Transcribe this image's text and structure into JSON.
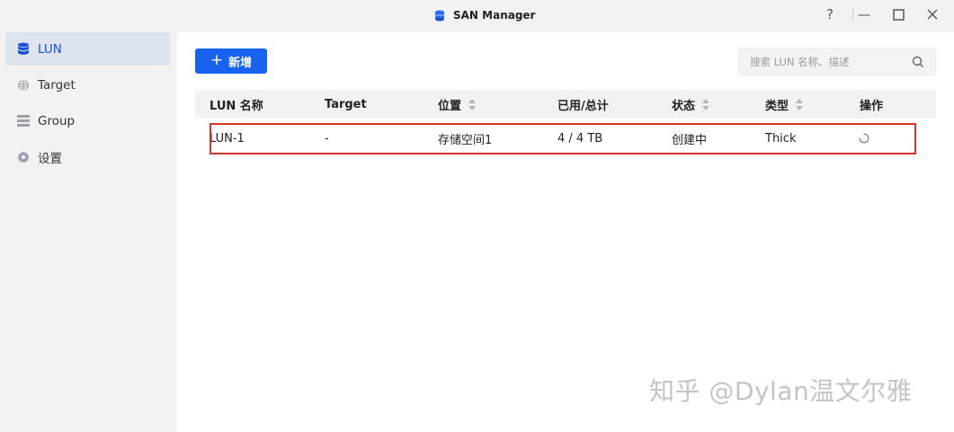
{
  "window": {
    "title": "SAN Manager",
    "controls": {
      "help": "?",
      "minimize": "—",
      "maximize": "☐",
      "close": "✕"
    }
  },
  "sidebar": {
    "items": [
      {
        "label": "LUN",
        "icon": "database-icon",
        "active": true
      },
      {
        "label": "Target",
        "icon": "globe-icon",
        "active": false
      },
      {
        "label": "Group",
        "icon": "list-icon",
        "active": false
      },
      {
        "label": "设置",
        "icon": "gear-icon",
        "active": false
      }
    ]
  },
  "toolbar": {
    "add_label": "新增",
    "search_placeholder": "搜索 LUN 名称、描述"
  },
  "table": {
    "columns": [
      {
        "label": "LUN 名称",
        "sortable": false
      },
      {
        "label": "Target",
        "sortable": false
      },
      {
        "label": "位置",
        "sortable": true
      },
      {
        "label": "已用/总计",
        "sortable": false
      },
      {
        "label": "状态",
        "sortable": true
      },
      {
        "label": "类型",
        "sortable": true
      },
      {
        "label": "操作",
        "sortable": false
      }
    ],
    "rows": [
      {
        "name": "LUN-1",
        "target": "-",
        "location": "存储空间1",
        "usage": "4 / 4 TB",
        "status": "创建中",
        "type": "Thick",
        "action_icon": "loading-spinner-icon"
      }
    ]
  },
  "colors": {
    "accent": "#1763f0",
    "active_sidebar_bg": "#dde4f0",
    "highlight_border": "#d9342b"
  },
  "watermark": "知乎 @Dylan温文尔雅"
}
